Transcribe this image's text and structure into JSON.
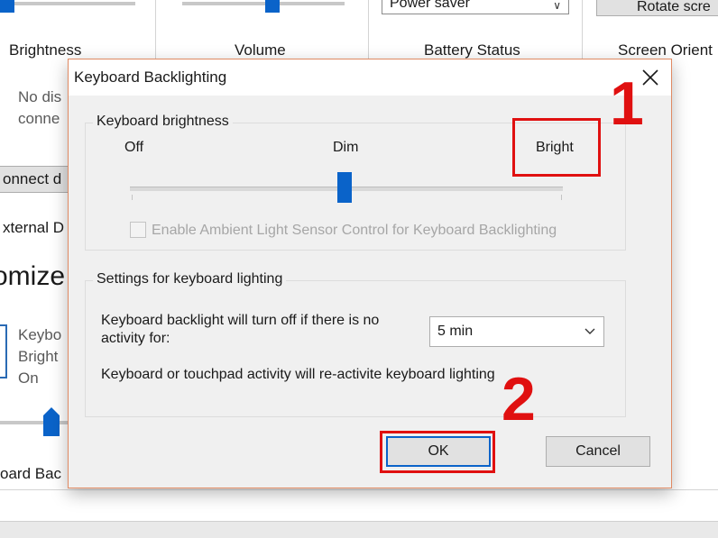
{
  "background": {
    "tiles": [
      {
        "label": "Brightness"
      },
      {
        "label": "Volume"
      },
      {
        "label": "Battery Status"
      },
      {
        "label": "Screen Orient"
      }
    ],
    "battery_select_value": "Power saver",
    "rotate_button_label": "Rotate scre",
    "display_status_line1": "No dis",
    "display_status_line2": "conne",
    "connect_button_label": "onnect d",
    "external_button_label": "xternal D",
    "customize_heading": "omize",
    "keyboard_line1": "Keybo",
    "keyboard_line2": "Bright",
    "keyboard_line3": "On",
    "keyboard_tile_label": "oard Bac"
  },
  "dialog": {
    "title": "Keyboard Backlighting",
    "brightness_group": {
      "legend": "Keyboard brightness",
      "levels": [
        "Off",
        "Dim",
        "Bright"
      ],
      "selected_level": "Dim",
      "ambient_label": "Enable Ambient Light Sensor Control for Keyboard Backlighting",
      "ambient_checked": false,
      "ambient_enabled": false
    },
    "settings_group": {
      "legend": "Settings for keyboard lighting",
      "timeout_label_line1": "Keyboard backlight will turn off if there is no",
      "timeout_label_line2": "activity for:",
      "timeout_value": "5 min",
      "reactivate_note": "Keyboard or touchpad activity will re-activite keyboard lighting"
    },
    "ok_label": "OK",
    "cancel_label": "Cancel"
  },
  "annotations": {
    "step1": "1",
    "step2": "2",
    "color": "#e01010"
  },
  "colors": {
    "accent": "#0a63c9",
    "dialog_bg": "#f0f0f0",
    "dialog_border": "#e08a63"
  }
}
